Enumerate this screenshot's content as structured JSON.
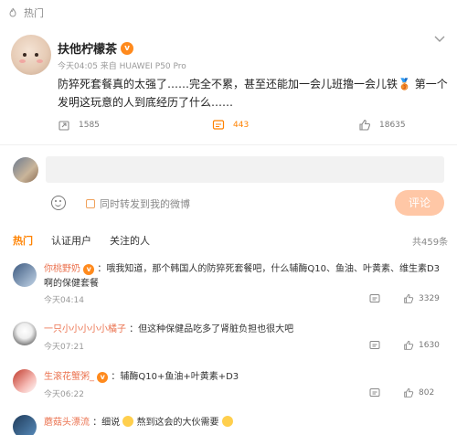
{
  "section": {
    "label": "热门"
  },
  "post": {
    "user_name": "扶他柠檬茶",
    "badge": "v",
    "meta": "今天04:05  来自 HUAWEI P50 Pro",
    "text": "防猝死套餐真的太强了……完全不累，甚至还能加一会儿班撸一会儿铁🥉 第一个发明这玩意的人到底经历了什么……",
    "repost_count": "1585",
    "comment_count": "443",
    "like_count": "18635"
  },
  "composer": {
    "placeholder": "",
    "repost_option": "同时转发到我的微博",
    "submit_label": "评论"
  },
  "tabs": [
    "热门",
    "认证用户",
    "关注的人"
  ],
  "total": "共459条",
  "comments": [
    {
      "user": "你桃野奶",
      "text": "：哦我知道，那个韩国人的防猝死套餐吧，什么辅酶Q10、鱼油、叶黄素、维生素D3啊的保健套餐",
      "time": "今天04:14",
      "likes": "3329"
    },
    {
      "user": "一只小小小小小橘子",
      "text": "：但这种保健品吃多了肾脏负担也很大吧",
      "time": "今天07:21",
      "likes": "1630"
    },
    {
      "user": "生滚花蟹粥_",
      "text": "：辅酶Q10+鱼油+叶黄素+D3",
      "time": "今天06:22",
      "likes": "802"
    },
    {
      "user": "蘑菇头漂流",
      "text_pre": "：细说",
      "text_mid": "熬到这会的大伙需要",
      "time": "",
      "likes": ""
    }
  ],
  "colors": {
    "accent": "#ff8200",
    "username": "#eb7350",
    "submit": "#ffc7a6"
  }
}
